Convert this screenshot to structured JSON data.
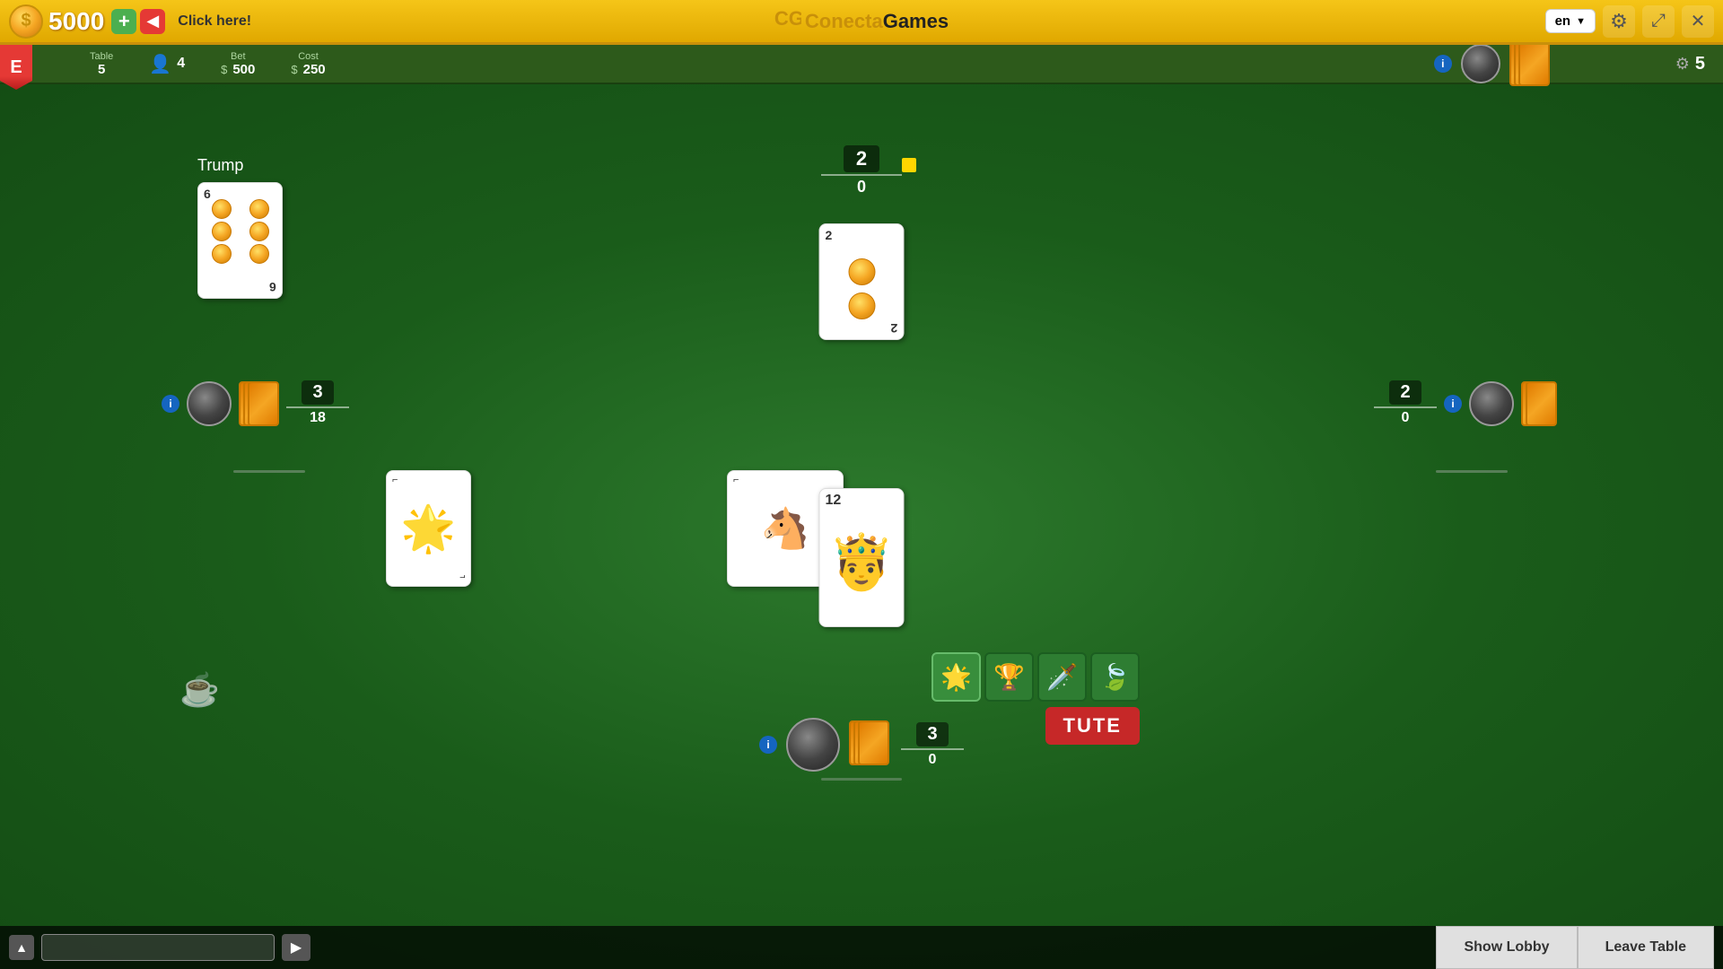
{
  "topbar": {
    "balance": "5000",
    "coin_symbol": "$",
    "add_label": "+",
    "arrow_label": "◀",
    "click_here": "Click here!",
    "logo_cg": "CG",
    "logo_conecta": "Conecta",
    "logo_games": "Games",
    "lang": "en",
    "lang_chevron": "▼"
  },
  "infobar": {
    "table_label": "Table",
    "table_value": "5",
    "players_value": "4",
    "bet_label": "Bet",
    "bet_symbol": "$",
    "bet_value": "500",
    "cost_label": "Cost",
    "cost_symbol": "$",
    "cost_value": "250",
    "deck_count": "5"
  },
  "ebadge": "E",
  "trump": {
    "label": "Trump",
    "card_number": "6",
    "pip_count": 6
  },
  "player_top": {
    "score": "2",
    "score_sub": "0"
  },
  "player_left": {
    "score": "3",
    "score_sub": "18"
  },
  "player_right": {
    "score": "2",
    "score_sub": "0"
  },
  "player_bottom": {
    "score": "3",
    "score_sub": "0"
  },
  "played_cards": {
    "top": {
      "number": "2"
    },
    "left": {
      "label": "sun"
    },
    "right": {
      "label": "horse"
    },
    "bottom": {
      "number": "12"
    }
  },
  "suit_selector": {
    "suits": [
      "🌟",
      "🏆",
      "🗡️",
      "🍃"
    ],
    "tute_label": "TUTE"
  },
  "chat": {
    "input_placeholder": "",
    "send_icon": "▶"
  },
  "buttons": {
    "show_lobby": "Show Lobby",
    "leave_table": "Leave Table",
    "collapse_icon": "▲"
  },
  "icons": {
    "settings": "⚙",
    "fullscreen": "⛶",
    "close": "✕",
    "coffee": "☕",
    "info": "i"
  }
}
